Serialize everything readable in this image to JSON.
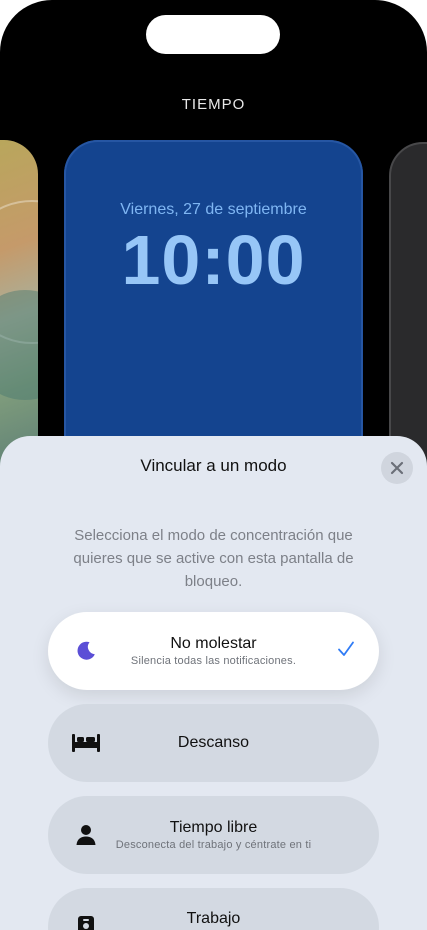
{
  "header": {
    "label": "TIEMPO"
  },
  "lockscreen": {
    "date": "Viernes, 27 de septiembre",
    "time": "10:00"
  },
  "sheet": {
    "title": "Vincular a un modo",
    "description": "Selecciona el modo de concentración que quieres que se active con esta pantalla de bloqueo.",
    "modes": [
      {
        "name": "No molestar",
        "subtitle": "Silencia todas las notificaciones.",
        "icon": "moon-icon",
        "selected": true
      },
      {
        "name": "Descanso",
        "subtitle": "",
        "icon": "bed-icon",
        "selected": false
      },
      {
        "name": "Tiempo libre",
        "subtitle": "Desconecta del trabajo y céntrate en ti",
        "icon": "person-icon",
        "selected": false
      },
      {
        "name": "Trabajo",
        "subtitle": "",
        "icon": "badge-icon",
        "selected": false
      }
    ]
  },
  "colors": {
    "accent": "#2f7bf5",
    "moon": "#5b4fd6",
    "lock_bg": "#14448f",
    "lock_text": "#97c6f7"
  }
}
